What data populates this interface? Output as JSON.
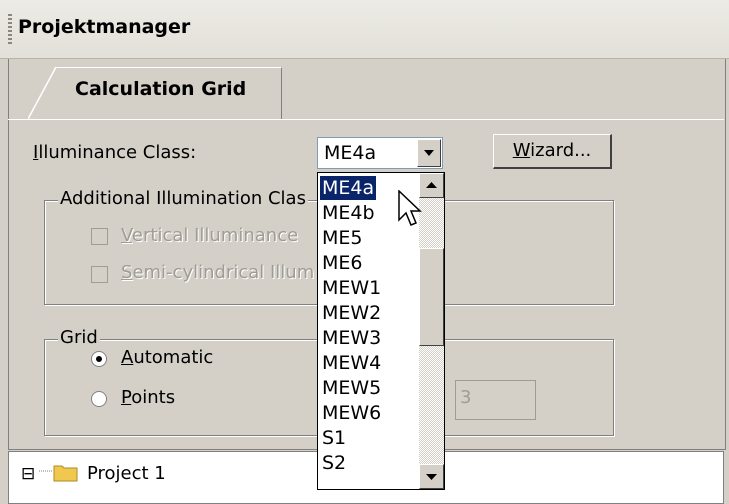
{
  "panel": {
    "title": "Projektmanager"
  },
  "tab": {
    "label": "Calculation Grid"
  },
  "illuminance": {
    "label_mnemonic": "I",
    "label_rest": "lluminance Class:",
    "selected": "ME4a"
  },
  "wizard": {
    "label_mnemonic": "W",
    "label_rest": "izard..."
  },
  "additional_group": {
    "legend": "Additional Illumination Clas",
    "vertical": {
      "mnemonic": "V",
      "rest": "ertical Illuminance"
    },
    "semicyl": {
      "mnemonic": "S",
      "rest": "emi-cylindrical Illum"
    }
  },
  "grid_group": {
    "legend": "Grid",
    "automatic": {
      "mnemonic": "A",
      "rest": "utomatic",
      "checked": true
    },
    "points": {
      "mnemonic": "P",
      "rest": "oints",
      "checked": false
    },
    "points_value": "3"
  },
  "dropdown": {
    "options": [
      "ME4a",
      "ME4b",
      "ME5",
      "ME6",
      "MEW1",
      "MEW2",
      "MEW3",
      "MEW4",
      "MEW5",
      "MEW6",
      "S1",
      "S2"
    ],
    "highlighted": "ME4a"
  },
  "tree": {
    "root": "Project 1",
    "expander": "⊟"
  }
}
